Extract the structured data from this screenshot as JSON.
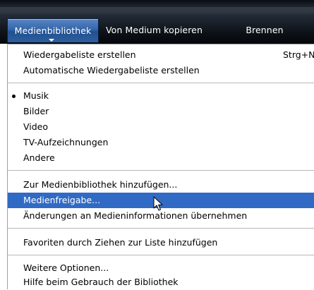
{
  "tabs": [
    {
      "label": "Medienbibliothek"
    },
    {
      "label": "Von Medium kopieren"
    },
    {
      "label": "Brennen"
    }
  ],
  "menu": {
    "groups": [
      [
        {
          "label": "Wiedergabeliste erstellen",
          "shortcut": "Strg+N"
        },
        {
          "label": "Automatische Wiedergabeliste erstellen"
        }
      ],
      [
        {
          "label": "Musik",
          "checked": true
        },
        {
          "label": "Bilder"
        },
        {
          "label": "Video"
        },
        {
          "label": "TV-Aufzeichnungen"
        },
        {
          "label": "Andere"
        }
      ],
      [
        {
          "label": "Zur Medienbibliothek hinzufügen..."
        },
        {
          "label": "Medienfreigabe...",
          "highlighted": true
        },
        {
          "label": "Änderungen an Medieninformationen übernehmen"
        }
      ],
      [
        {
          "label": "Favoriten durch Ziehen zur Liste hinzufügen"
        }
      ],
      [
        {
          "label": "Weitere Optionen..."
        },
        {
          "label": "Hilfe beim Gebrauch der Bibliothek"
        }
      ]
    ]
  },
  "colors": {
    "highlight": "#316ac5",
    "active_tab": "#3466aa"
  }
}
